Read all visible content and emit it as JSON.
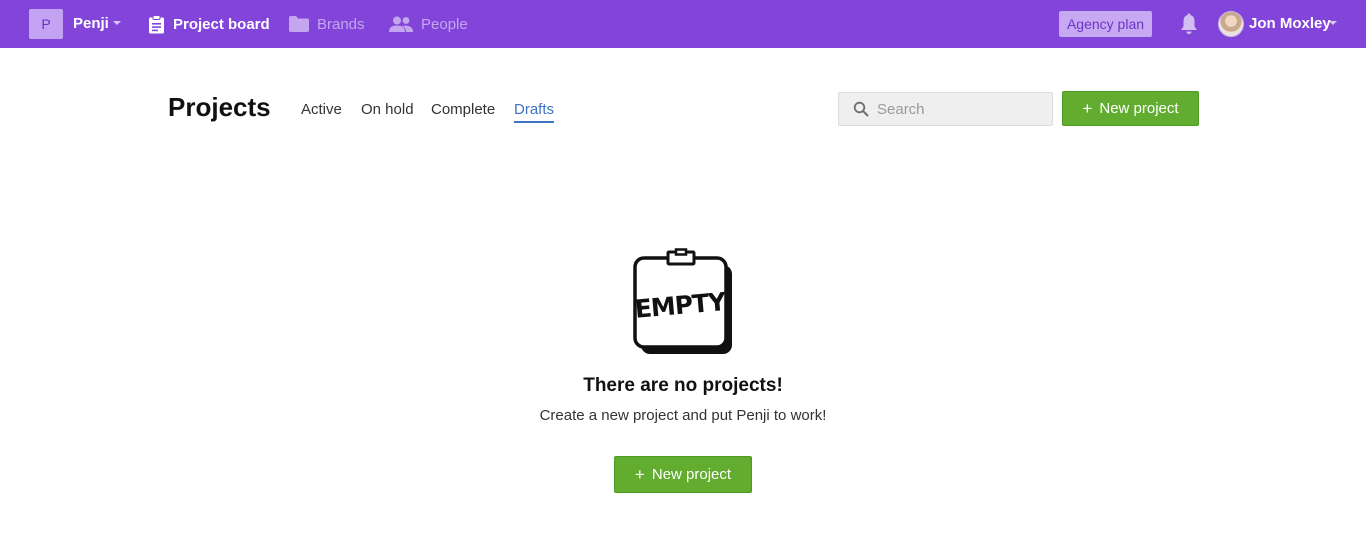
{
  "topbar": {
    "workspace_initial": "P",
    "workspace_name": "Penji",
    "nav": [
      {
        "label": "Project board",
        "icon": "clipboard-icon",
        "active": true
      },
      {
        "label": "Brands",
        "icon": "folder-icon",
        "active": false
      },
      {
        "label": "People",
        "icon": "people-icon",
        "active": false
      }
    ],
    "plan_label": "Agency plan",
    "user_name": "Jon Moxley"
  },
  "header": {
    "title": "Projects",
    "tabs": [
      {
        "label": "Active",
        "selected": false
      },
      {
        "label": "On hold",
        "selected": false
      },
      {
        "label": "Complete",
        "selected": false
      },
      {
        "label": "Drafts",
        "selected": true
      }
    ],
    "search_placeholder": "Search",
    "new_project_label": "New project"
  },
  "empty_state": {
    "illustration_text": "EMPTY",
    "title": "There are no projects!",
    "subtitle": "Create a new project and put Penji to work!",
    "button_label": "New project"
  },
  "colors": {
    "brand": "#8244d9",
    "accent_green": "#62ad2f",
    "tab_active": "#3f73c6"
  }
}
